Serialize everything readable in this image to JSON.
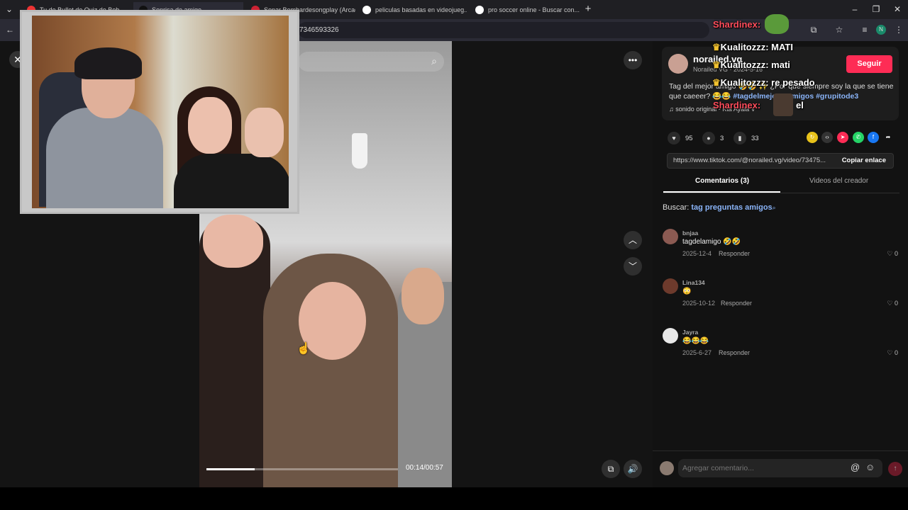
{
  "browser": {
    "tabs": [
      {
        "title": "Tu de Bullet de Quiz de Beb..."
      },
      {
        "title": "Sonrisa de amigo..."
      },
      {
        "title": "Sonar Bombardesongplay (Arcade) |"
      },
      {
        "title": "peliculas basadas en videojueg..."
      },
      {
        "title": "pro soccer online - Buscar con..."
      }
    ],
    "new_tab": "+",
    "url_fragment": "7346593326",
    "profile_initial": "N"
  },
  "video": {
    "time": "00:14/00:57",
    "progress": 0.25
  },
  "author": {
    "name": "norailed.vg",
    "subtitle": "Norailed VG · 2024-5-16",
    "follow_label": "Seguir"
  },
  "post": {
    "description_text": "Tag del mejor amigo 🤣🤣 ✨ ¿Por qué siempre soy la que se tiene que caeeer? 😂😂",
    "hashtags": "#tagdelmejoresamigos #grupitode3",
    "sound": "sonido original - Kta Ayala V"
  },
  "stats": {
    "likes": "95",
    "comments": "3",
    "saves": "33"
  },
  "link": {
    "url": "https://www.tiktok.com/@norailed.vg/video/73475...",
    "copy_label": "Copiar enlace"
  },
  "tabs": {
    "comments": "Comentarios (3)",
    "creator_videos": "Videos del creador"
  },
  "search": {
    "label": "Buscar:",
    "query": "tag preguntas amigos"
  },
  "comments": [
    {
      "user": "bnjaa",
      "text": "tagdelamigo 🤣🤣",
      "date": "2025-12-4",
      "reply": "Responder",
      "likes": "0"
    },
    {
      "user": "Lina134",
      "text": "😳",
      "date": "2025-10-12",
      "reply": "Responder",
      "likes": "0"
    },
    {
      "user": "Jayra",
      "text": "😂😂😂",
      "date": "2025-6-27",
      "reply": "Responder",
      "likes": "0"
    }
  ],
  "comment_input": {
    "placeholder": "Agregar comentario..."
  },
  "stream_chat": [
    {
      "user": "Shardinex:",
      "msg": ""
    },
    {
      "user": "Kualitozzz:",
      "msg": "MATI"
    },
    {
      "user": "Kualitozzz:",
      "msg": "mati"
    },
    {
      "user": "Kualitozzz:",
      "msg": "re pesado"
    },
    {
      "user": "Shardinex:",
      "msg": "el"
    }
  ],
  "colors": {
    "follow": "#fe2c55",
    "hashtag": "#8ab4f8",
    "chat_red": "#ff4c5b"
  }
}
